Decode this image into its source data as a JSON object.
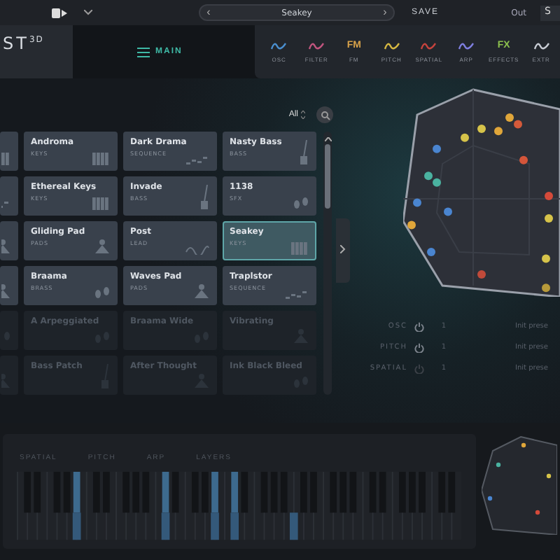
{
  "top_bar": {
    "prev": "‹",
    "preset": "Seakey",
    "next": "›",
    "save": "SAVE",
    "output_label": "Out",
    "output_value": "S"
  },
  "header": {
    "logo": "ST",
    "logo_sup": "3D",
    "main_tab": {
      "label": "MAIN",
      "selected": true
    },
    "modules": [
      {
        "kind": "icon",
        "label": "OSC",
        "color": "#4a8fd0"
      },
      {
        "kind": "icon",
        "label": "FILTER",
        "color": "#c2557f"
      },
      {
        "kind": "text",
        "glyph": "FM",
        "label": "FM",
        "color": "#d8a24a"
      },
      {
        "kind": "icon",
        "label": "PITCH",
        "color": "#d6b842"
      },
      {
        "kind": "icon",
        "label": "SPATIAL",
        "color": "#c6433d"
      },
      {
        "kind": "icon",
        "label": "ARP",
        "color": "#7f7fe0"
      },
      {
        "kind": "text",
        "glyph": "FX",
        "label": "EFFECTS",
        "color": "#8cc04e"
      },
      {
        "kind": "icon",
        "label": "EXTR",
        "color": "#c8ccd4"
      }
    ]
  },
  "browser": {
    "filter": "All",
    "rows": [
      {
        "dim": false,
        "cells": [
          {
            "kind": "keys",
            "selected": false
          },
          {
            "kind": "keys",
            "name": "Andromа",
            "category": "KEYS",
            "selected": false
          },
          {
            "kind": "sequence",
            "name": "Dark Drama",
            "category": "SEQUENCE",
            "selected": false
          },
          {
            "kind": "bass",
            "name": "Nasty Bass",
            "category": "BASS",
            "selected": false
          }
        ]
      },
      {
        "dim": false,
        "cells": [
          {
            "kind": "sequence",
            "selected": false
          },
          {
            "kind": "keys",
            "name": "Ethereal Keys",
            "category": "KEYS",
            "selected": false
          },
          {
            "kind": "bass",
            "name": "Invade",
            "category": "BASS",
            "selected": false
          },
          {
            "kind": "sfx",
            "name": "1138",
            "category": "SFX",
            "selected": false
          }
        ]
      },
      {
        "dim": false,
        "cells": [
          {
            "kind": "pads",
            "selected": false
          },
          {
            "kind": "pads",
            "name": "Gliding Pad",
            "category": "PADS",
            "selected": false
          },
          {
            "kind": "lead",
            "name": "Post",
            "category": "LEAD",
            "selected": false
          },
          {
            "kind": "keys",
            "name": "Seakey",
            "category": "KEYS",
            "selected": true
          }
        ]
      },
      {
        "dim": false,
        "cells": [
          {
            "kind": "pads",
            "selected": false
          },
          {
            "kind": "sfx",
            "name": "Braama",
            "category": "BRASS",
            "selected": false
          },
          {
            "kind": "pads",
            "name": "Waves Pad",
            "category": "PADS",
            "selected": false
          },
          {
            "kind": "sequence",
            "name": "Traplstor",
            "category": "SEQUENCE",
            "selected": false
          }
        ]
      },
      {
        "dim": true,
        "cells": [
          {
            "kind": "sfx",
            "selected": false
          },
          {
            "kind": "sfx",
            "name": "A Arpeggiated",
            "selected": false
          },
          {
            "kind": "sfx",
            "name": "Braama Wide",
            "selected": false
          },
          {
            "kind": "pads",
            "name": "Vibrating",
            "selected": false
          }
        ]
      },
      {
        "dim": true,
        "cells": [
          {
            "kind": "pads",
            "selected": false
          },
          {
            "kind": "bass",
            "name": "Bass Patch",
            "selected": false
          },
          {
            "kind": "pads",
            "name": "After Thought",
            "selected": false
          },
          {
            "kind": "sfx",
            "name": "Ink Black Bleed",
            "selected": false
          }
        ]
      }
    ]
  },
  "layers": [
    {
      "label": "OSC",
      "on": true,
      "value": "1",
      "preset": "Init prese"
    },
    {
      "label": "PITCH",
      "on": true,
      "value": "1",
      "preset": "Init prese"
    },
    {
      "label": "SPATIAL",
      "on": false,
      "value": "1",
      "preset": "Init prese"
    }
  ],
  "keyboard": {
    "tabs": [
      {
        "label": "SPATIAL",
        "selected": false
      },
      {
        "label": "PITCH",
        "selected": false
      },
      {
        "label": "ARP",
        "selected": false
      },
      {
        "label": "LAYERS",
        "selected": false
      }
    ]
  }
}
